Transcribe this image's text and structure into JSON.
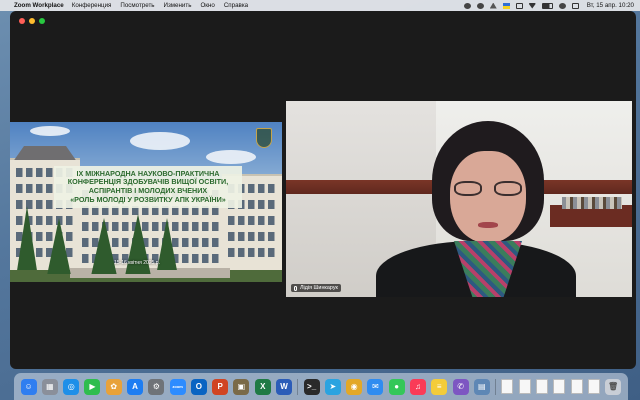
{
  "menubar": {
    "apple_glyph": "",
    "app_name": "Zoom Workplace",
    "menus": [
      "Конференция",
      "Посмотреть",
      "Изменить",
      "Окно",
      "Справка"
    ],
    "clock": "Вт, 15 апр.  10:20"
  },
  "shared_screen": {
    "title_lines": [
      "IX МІЖНАРОДНА НАУКОВО-ПРАКТИЧНА",
      "КОНФЕРЕНЦІЯ ЗДОБУВАЧІВ ВИЩОЇ ОСВІТИ,",
      "АСПІРАНТІВ І МОЛОДИХ ВЧЕНИХ",
      "«РОЛЬ МОЛОДІ У РОЗВИТКУ АПК УКРАЇНИ»"
    ],
    "date": "15-16 квітня 2025 р."
  },
  "participant": {
    "name": "Лідія Шинкарук"
  },
  "dock": {
    "apps": [
      {
        "icon": "finder-icon",
        "glyph": "☺",
        "color": "#2f7ef0"
      },
      {
        "icon": "launchpad-icon",
        "glyph": "▦",
        "color": "#8a8f9a"
      },
      {
        "icon": "safari-icon",
        "glyph": "◎",
        "color": "#1e8fe8"
      },
      {
        "icon": "facetime-icon",
        "glyph": "▶",
        "color": "#2fbd4e"
      },
      {
        "icon": "photos-icon",
        "glyph": "✿",
        "color": "#e8a23a"
      },
      {
        "icon": "app-store-icon",
        "glyph": "A",
        "color": "#1d7df2"
      },
      {
        "icon": "system-settings-icon",
        "glyph": "⚙",
        "color": "#6f7378"
      },
      {
        "icon": "zoom-icon",
        "glyph": "zoom",
        "color": "#2d8cff"
      },
      {
        "icon": "outlook-icon",
        "glyph": "O",
        "color": "#0a64c2"
      },
      {
        "icon": "powerpoint-icon",
        "glyph": "P",
        "color": "#d04423"
      },
      {
        "icon": "archive-utility-icon",
        "glyph": "▣",
        "color": "#7a6a48"
      },
      {
        "icon": "excel-icon",
        "glyph": "X",
        "color": "#1f7a45"
      },
      {
        "icon": "word-icon",
        "glyph": "W",
        "color": "#2b5cb8"
      },
      {
        "icon": "terminal-icon",
        "glyph": ">_",
        "color": "#2a2a2a"
      },
      {
        "icon": "telegram-icon",
        "glyph": "➤",
        "color": "#2aa3e0"
      },
      {
        "icon": "chrome-icon",
        "glyph": "◉",
        "color": "#e3a826"
      },
      {
        "icon": "mail-icon",
        "glyph": "✉",
        "color": "#2f8cf0"
      },
      {
        "icon": "messages-icon",
        "glyph": "●",
        "color": "#34c759"
      },
      {
        "icon": "music-icon",
        "glyph": "♫",
        "color": "#fa3b57"
      },
      {
        "icon": "notes-icon",
        "glyph": "≡",
        "color": "#f3cc39"
      },
      {
        "icon": "viber-icon",
        "glyph": "✆",
        "color": "#7d56c2"
      },
      {
        "icon": "preview-icon",
        "glyph": "▤",
        "color": "#5e87b5"
      }
    ],
    "trash_icon": "trash-icon"
  }
}
